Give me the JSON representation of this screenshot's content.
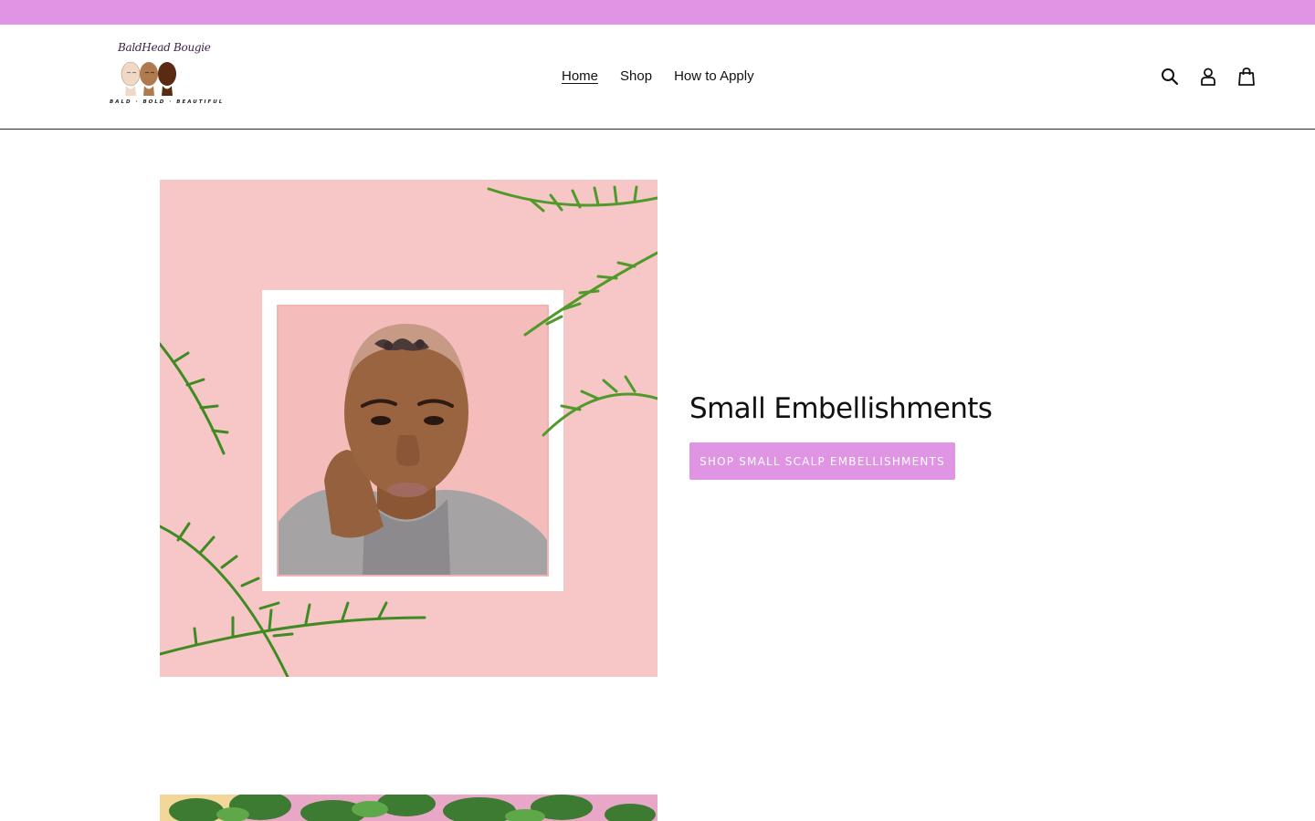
{
  "brand": {
    "script_name": "BaldHead Bougie",
    "tagline": "BALD · BOLD · BEAUTIFUL"
  },
  "nav": {
    "items": [
      {
        "label": "Home",
        "active": true
      },
      {
        "label": "Shop",
        "active": false
      },
      {
        "label": "How to Apply",
        "active": false
      }
    ]
  },
  "header_icons": [
    "search-icon",
    "account-icon",
    "cart-icon"
  ],
  "hero": {
    "title": "Small Embellishments",
    "button_label": "SHOP SMALL SCALP EMBELLISHMENTS"
  },
  "colors": {
    "accent": "#e094e4",
    "hero_background": "#f7c9c9",
    "text": "#111111"
  }
}
